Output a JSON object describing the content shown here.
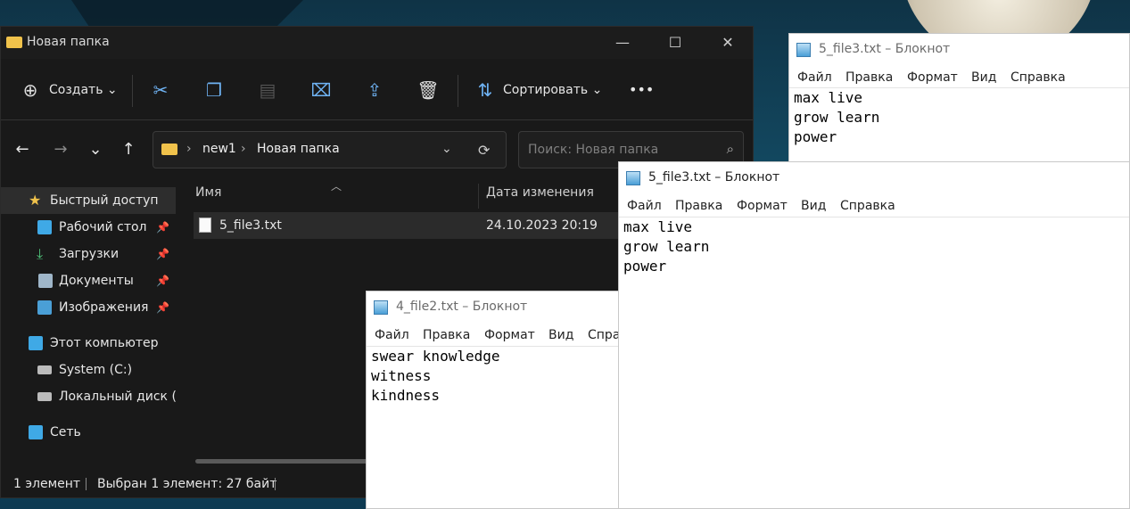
{
  "explorer": {
    "title": "Новая папка",
    "toolbar": {
      "create": "Создать",
      "sort": "Сортировать",
      "more": "•••"
    },
    "breadcrumb": [
      "new1",
      "Новая папка"
    ],
    "search_placeholder": "Поиск: Новая папка",
    "sidebar": [
      {
        "label": "Быстрый доступ",
        "icon": "star-icon",
        "pinned": false
      },
      {
        "label": "Рабочий стол",
        "icon": "desktop-icon",
        "pinned": true
      },
      {
        "label": "Загрузки",
        "icon": "download-icon",
        "pinned": true
      },
      {
        "label": "Документы",
        "icon": "documents-icon",
        "pinned": true
      },
      {
        "label": "Изображения",
        "icon": "pictures-icon",
        "pinned": true
      },
      {
        "label": "Этот компьютер",
        "icon": "computer-icon",
        "pinned": false
      },
      {
        "label": "System (C:)",
        "icon": "drive-icon",
        "pinned": false
      },
      {
        "label": "Локальный диск (D",
        "icon": "drive-icon",
        "pinned": false
      },
      {
        "label": "Сеть",
        "icon": "network-icon",
        "pinned": false
      }
    ],
    "columns": {
      "name": "Имя",
      "date": "Дата изменения"
    },
    "files": [
      {
        "name": "5_file3.txt",
        "date": "24.10.2023 20:19"
      }
    ],
    "status": {
      "count": "1 элемент",
      "selected": "Выбран 1 элемент: 27 байт"
    }
  },
  "notepad_back": {
    "title": "5_file3.txt – Блокнот",
    "menu": [
      "Файл",
      "Правка",
      "Формат",
      "Вид",
      "Справка"
    ],
    "lines": [
      "max live",
      "grow learn",
      "power"
    ]
  },
  "notepad_front": {
    "title": "5_file3.txt – Блокнот",
    "menu": [
      "Файл",
      "Правка",
      "Формат",
      "Вид",
      "Справка"
    ],
    "lines": [
      "max live",
      "grow learn",
      "power"
    ]
  },
  "notepad_mid": {
    "title": "4_file2.txt – Блокнот",
    "menu": [
      "Файл",
      "Правка",
      "Формат",
      "Вид",
      "Спра"
    ],
    "lines": [
      "swear knowledge",
      "witness",
      "kindness"
    ]
  },
  "colors": {
    "accent": "#6fb3f4",
    "folder": "#f0c24b",
    "explorer_bg": "#191919"
  }
}
